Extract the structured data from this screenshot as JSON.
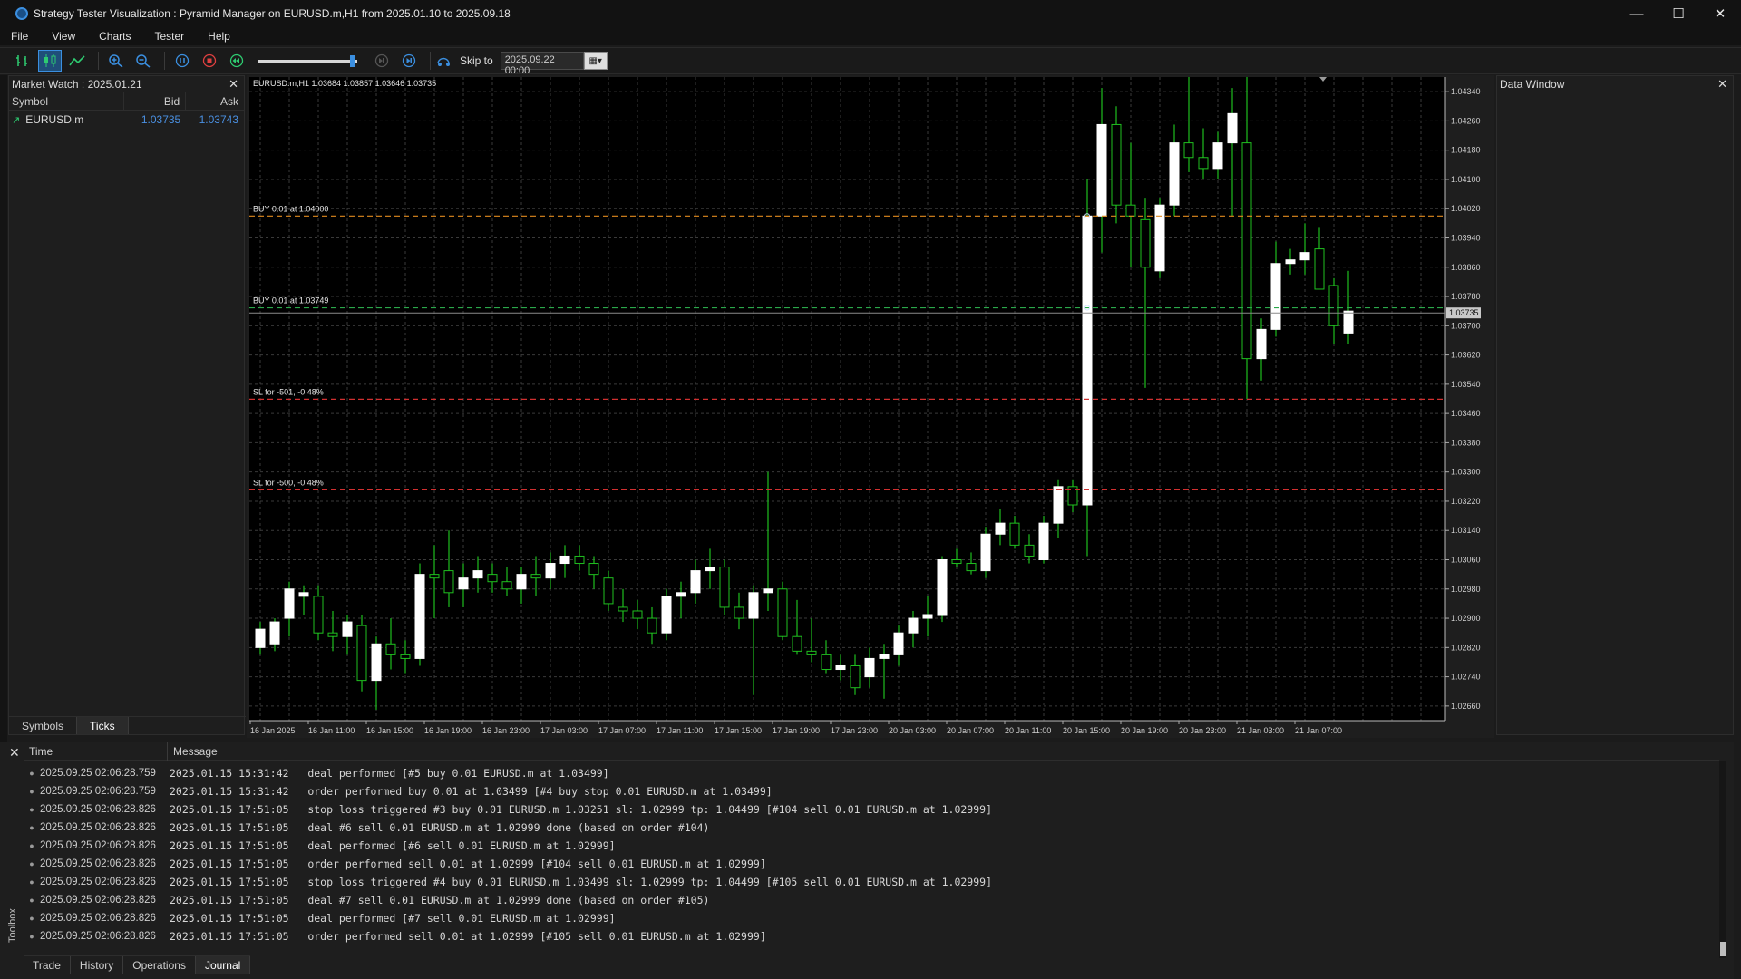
{
  "window": {
    "title": "Strategy Tester Visualization : Pyramid Manager on EURUSD.m,H1 from 2025.01.10 to 2025.09.18",
    "minimize": "—",
    "maximize": "☐",
    "close": "✕"
  },
  "menu": [
    "File",
    "View",
    "Charts",
    "Tester",
    "Help"
  ],
  "toolbar": {
    "skip_label": "Skip to",
    "skip_date": "2025.09.22 00:00",
    "slider_level": 0.93,
    "icons": [
      "bar-chart-icon",
      "candlestick-icon",
      "line-chart-icon",
      "zoom-in-icon",
      "zoom-out-icon",
      "pause-icon",
      "stop-icon",
      "step-back-icon",
      "step-icon",
      "step-forward-icon"
    ]
  },
  "market_watch": {
    "title": "Market Watch : 2025.01.21",
    "columns": {
      "symbol": "Symbol",
      "bid": "Bid",
      "ask": "Ask"
    },
    "rows": [
      {
        "symbol": "EURUSD.m",
        "bid": "1.03735",
        "ask": "1.03743"
      }
    ],
    "tabs": [
      "Symbols",
      "Ticks"
    ]
  },
  "data_window": {
    "title": "Data Window"
  },
  "chart_data": {
    "type": "candlestick",
    "title": "EURUSD.m,H1  1.03684 1.03857 1.03646 1.03735",
    "ylim": [
      1.0262,
      1.0438
    ],
    "y_ticks": [
      "1.04340",
      "1.04260",
      "1.04180",
      "1.04100",
      "1.04020",
      "1.03940",
      "1.03860",
      "1.03780",
      "1.03700",
      "1.03620",
      "1.03540",
      "1.03460",
      "1.03380",
      "1.03300",
      "1.03220",
      "1.03140",
      "1.03060",
      "1.02980",
      "1.02900",
      "1.02820",
      "1.02740",
      "1.02660"
    ],
    "x_ticks": [
      "16 Jan 2025",
      "16 Jan 11:00",
      "16 Jan 15:00",
      "16 Jan 19:00",
      "16 Jan 23:00",
      "17 Jan 03:00",
      "17 Jan 07:00",
      "17 Jan 11:00",
      "17 Jan 15:00",
      "17 Jan 19:00",
      "17 Jan 23:00",
      "20 Jan 03:00",
      "20 Jan 07:00",
      "20 Jan 11:00",
      "20 Jan 15:00",
      "20 Jan 19:00",
      "20 Jan 23:00",
      "21 Jan 03:00",
      "21 Jan 07:00"
    ],
    "current_price": "1.03735",
    "current_price_value": 1.03735,
    "lines": [
      {
        "label": "BUY 0.01 at 1.04000",
        "price": 1.04,
        "color": "#e08a1e"
      },
      {
        "label": "BUY 0.01 at 1.03749",
        "price": 1.03749,
        "color": "#2aa84a"
      },
      {
        "label": "SL for -501, -0.48%",
        "price": 1.03499,
        "color": "#d23030"
      },
      {
        "label": "SL for -500, -0.48%",
        "price": 1.03251,
        "color": "#d23030"
      }
    ],
    "candles": [
      [
        1.0282,
        1.0289,
        1.028,
        1.0287
      ],
      [
        1.0283,
        1.029,
        1.0281,
        1.0289
      ],
      [
        1.029,
        1.03,
        1.0285,
        1.0298
      ],
      [
        1.0296,
        1.0299,
        1.0291,
        1.0297
      ],
      [
        1.0296,
        1.0299,
        1.0284,
        1.0286
      ],
      [
        1.0286,
        1.0292,
        1.0281,
        1.0285
      ],
      [
        1.0285,
        1.0291,
        1.028,
        1.0289
      ],
      [
        1.0288,
        1.0291,
        1.027,
        1.0273
      ],
      [
        1.0273,
        1.0285,
        1.0265,
        1.0283
      ],
      [
        1.0283,
        1.029,
        1.0276,
        1.028
      ],
      [
        1.028,
        1.0284,
        1.0275,
        1.0279
      ],
      [
        1.0279,
        1.0305,
        1.0277,
        1.0302
      ],
      [
        1.0302,
        1.031,
        1.029,
        1.0301
      ],
      [
        1.0303,
        1.0314,
        1.0293,
        1.0297
      ],
      [
        1.0298,
        1.0305,
        1.0293,
        1.0301
      ],
      [
        1.0301,
        1.0307,
        1.0297,
        1.0303
      ],
      [
        1.0302,
        1.0305,
        1.0297,
        1.03
      ],
      [
        1.03,
        1.0304,
        1.0296,
        1.0298
      ],
      [
        1.0298,
        1.0304,
        1.0294,
        1.0302
      ],
      [
        1.0302,
        1.0307,
        1.0296,
        1.0301
      ],
      [
        1.0301,
        1.0308,
        1.0298,
        1.0305
      ],
      [
        1.0305,
        1.031,
        1.0301,
        1.0307
      ],
      [
        1.0307,
        1.031,
        1.0303,
        1.0305
      ],
      [
        1.0305,
        1.0307,
        1.0298,
        1.0302
      ],
      [
        1.0301,
        1.0303,
        1.0292,
        1.0294
      ],
      [
        1.0293,
        1.0298,
        1.0289,
        1.0292
      ],
      [
        1.0292,
        1.0295,
        1.0287,
        1.029
      ],
      [
        1.029,
        1.0293,
        1.0283,
        1.0286
      ],
      [
        1.0286,
        1.0298,
        1.0284,
        1.0296
      ],
      [
        1.0296,
        1.03,
        1.029,
        1.0297
      ],
      [
        1.0297,
        1.0306,
        1.0294,
        1.0303
      ],
      [
        1.0303,
        1.0309,
        1.0298,
        1.0304
      ],
      [
        1.0304,
        1.0306,
        1.0291,
        1.0293
      ],
      [
        1.0293,
        1.0297,
        1.0287,
        1.029
      ],
      [
        1.029,
        1.0299,
        1.0269,
        1.0297
      ],
      [
        1.0297,
        1.033,
        1.0292,
        1.0298
      ],
      [
        1.0298,
        1.03,
        1.0284,
        1.0285
      ],
      [
        1.0285,
        1.0295,
        1.028,
        1.0281
      ],
      [
        1.0281,
        1.029,
        1.0278,
        1.028
      ],
      [
        1.028,
        1.0284,
        1.0275,
        1.0276
      ],
      [
        1.0276,
        1.028,
        1.0273,
        1.0277
      ],
      [
        1.0277,
        1.028,
        1.0269,
        1.0271
      ],
      [
        1.0274,
        1.0282,
        1.0271,
        1.0279
      ],
      [
        1.0279,
        1.0283,
        1.0268,
        1.028
      ],
      [
        1.028,
        1.0288,
        1.0277,
        1.0286
      ],
      [
        1.0286,
        1.0292,
        1.0282,
        1.029
      ],
      [
        1.029,
        1.0296,
        1.0285,
        1.0291
      ],
      [
        1.0291,
        1.0307,
        1.0289,
        1.0306
      ],
      [
        1.0306,
        1.0309,
        1.0304,
        1.0305
      ],
      [
        1.0305,
        1.0308,
        1.0302,
        1.0303
      ],
      [
        1.0303,
        1.0315,
        1.0301,
        1.0313
      ],
      [
        1.0313,
        1.032,
        1.031,
        1.0316
      ],
      [
        1.0316,
        1.0318,
        1.0309,
        1.031
      ],
      [
        1.031,
        1.0313,
        1.0305,
        1.0307
      ],
      [
        1.0306,
        1.0318,
        1.0305,
        1.0316
      ],
      [
        1.0316,
        1.0328,
        1.0312,
        1.0326
      ],
      [
        1.0326,
        1.0328,
        1.0319,
        1.0321
      ],
      [
        1.0321,
        1.041,
        1.0307,
        1.04
      ],
      [
        1.04,
        1.0435,
        1.039,
        1.0425
      ],
      [
        1.0425,
        1.043,
        1.0398,
        1.0403
      ],
      [
        1.0403,
        1.042,
        1.0386,
        1.04
      ],
      [
        1.0399,
        1.0405,
        1.0353,
        1.0386
      ],
      [
        1.0385,
        1.0405,
        1.0383,
        1.0403
      ],
      [
        1.0403,
        1.0425,
        1.04,
        1.042
      ],
      [
        1.042,
        1.0438,
        1.0412,
        1.0416
      ],
      [
        1.0416,
        1.0424,
        1.041,
        1.0413
      ],
      [
        1.0413,
        1.0423,
        1.041,
        1.042
      ],
      [
        1.042,
        1.0435,
        1.04,
        1.0428
      ],
      [
        1.042,
        1.0438,
        1.035,
        1.0361
      ],
      [
        1.0361,
        1.0372,
        1.0355,
        1.0369
      ],
      [
        1.0369,
        1.0393,
        1.0367,
        1.0387
      ],
      [
        1.0387,
        1.0391,
        1.0384,
        1.0388
      ],
      [
        1.0388,
        1.0398,
        1.0384,
        1.039
      ],
      [
        1.0391,
        1.0397,
        1.038,
        1.038
      ],
      [
        1.0381,
        1.0383,
        1.0365,
        1.037
      ],
      [
        1.0368,
        1.0385,
        1.0365,
        1.0374
      ]
    ]
  },
  "toolbox": {
    "label": "Toolbox",
    "columns": {
      "time": "Time",
      "message": "Message"
    },
    "rows": [
      {
        "time": "2025.09.25 02:06:28.759",
        "message": "2025.01.15 15:31:42   deal performed [#5 buy 0.01 EURUSD.m at 1.03499]"
      },
      {
        "time": "2025.09.25 02:06:28.759",
        "message": "2025.01.15 15:31:42   order performed buy 0.01 at 1.03499 [#4 buy stop 0.01 EURUSD.m at 1.03499]"
      },
      {
        "time": "2025.09.25 02:06:28.826",
        "message": "2025.01.15 17:51:05   stop loss triggered #3 buy 0.01 EURUSD.m 1.03251 sl: 1.02999 tp: 1.04499 [#104 sell 0.01 EURUSD.m at 1.02999]"
      },
      {
        "time": "2025.09.25 02:06:28.826",
        "message": "2025.01.15 17:51:05   deal #6 sell 0.01 EURUSD.m at 1.02999 done (based on order #104)"
      },
      {
        "time": "2025.09.25 02:06:28.826",
        "message": "2025.01.15 17:51:05   deal performed [#6 sell 0.01 EURUSD.m at 1.02999]"
      },
      {
        "time": "2025.09.25 02:06:28.826",
        "message": "2025.01.15 17:51:05   order performed sell 0.01 at 1.02999 [#104 sell 0.01 EURUSD.m at 1.02999]"
      },
      {
        "time": "2025.09.25 02:06:28.826",
        "message": "2025.01.15 17:51:05   stop loss triggered #4 buy 0.01 EURUSD.m 1.03499 sl: 1.02999 tp: 1.04499 [#105 sell 0.01 EURUSD.m at 1.02999]"
      },
      {
        "time": "2025.09.25 02:06:28.826",
        "message": "2025.01.15 17:51:05   deal #7 sell 0.01 EURUSD.m at 1.02999 done (based on order #105)"
      },
      {
        "time": "2025.09.25 02:06:28.826",
        "message": "2025.01.15 17:51:05   deal performed [#7 sell 0.01 EURUSD.m at 1.02999]"
      },
      {
        "time": "2025.09.25 02:06:28.826",
        "message": "2025.01.15 17:51:05   order performed sell 0.01 at 1.02999 [#105 sell 0.01 EURUSD.m at 1.02999]"
      }
    ],
    "tabs": [
      "Trade",
      "History",
      "Operations",
      "Journal"
    ],
    "active_tab": "Journal"
  },
  "colors": {
    "bull": "#ffffff",
    "wick": "#1fbf1f",
    "axis_text": "#cfcfcf",
    "grid": "#3a3a3a",
    "chart_bg": "#000000",
    "accent": "#3b8fe0"
  }
}
